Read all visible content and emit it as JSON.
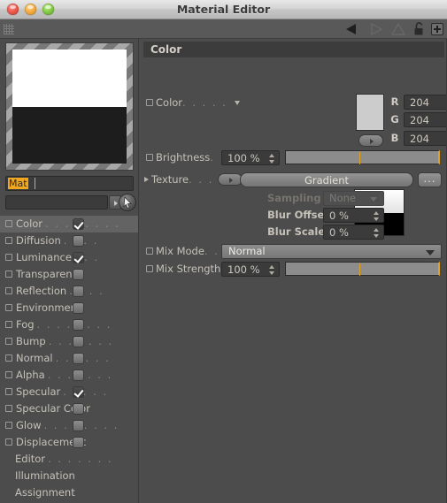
{
  "window": {
    "title": "Material Editor",
    "controls": [
      "close",
      "minimize",
      "zoom"
    ]
  },
  "toolbar": {
    "icons": [
      {
        "name": "back-arrow-icon",
        "label": "Back",
        "enabled": true
      },
      {
        "name": "forward-arrow-icon",
        "label": "Forward",
        "enabled": false
      },
      {
        "name": "up-arrow-icon",
        "label": "Up",
        "enabled": false
      },
      {
        "name": "unlock-icon",
        "label": "Unlock",
        "enabled": true
      },
      {
        "name": "add-icon",
        "label": "+",
        "enabled": true
      }
    ]
  },
  "left_panel": {
    "material_name": "Mat",
    "filter_value": "",
    "channels": [
      {
        "label": "Color",
        "dots": ". . . . . . . .",
        "checked": true,
        "selected": true
      },
      {
        "label": "Diffusion",
        "dots": ". . . .",
        "checked": false,
        "selected": false
      },
      {
        "label": "Luminance",
        "dots": ". . .",
        "checked": true,
        "selected": false
      },
      {
        "label": "Transparency",
        "dots": "",
        "checked": false,
        "selected": false
      },
      {
        "label": "Reflection",
        "dots": ". . . .",
        "checked": false,
        "selected": false
      },
      {
        "label": "Environment",
        "dots": "",
        "checked": false,
        "selected": false
      },
      {
        "label": "Fog",
        "dots": ". . . . . . . .",
        "checked": false,
        "selected": false
      },
      {
        "label": "Bump",
        "dots": ". . . . . . .",
        "checked": false,
        "selected": false
      },
      {
        "label": "Normal",
        "dots": ". . . . . .",
        "checked": false,
        "selected": false
      },
      {
        "label": "Alpha",
        "dots": ". . . . . . .",
        "checked": false,
        "selected": false
      },
      {
        "label": "Specular",
        "dots": ". . . . .",
        "checked": true,
        "selected": false
      },
      {
        "label": "Specular Color",
        "dots": "",
        "checked": false,
        "selected": false
      },
      {
        "label": "Glow",
        "dots": ". . . . . . . .",
        "checked": false,
        "selected": false
      },
      {
        "label": "Displacement",
        "dots": "",
        "checked": false,
        "selected": false
      }
    ],
    "pages": [
      {
        "label": "Editor",
        "dots": ". . . . . . ."
      },
      {
        "label": "Illumination",
        "dots": ""
      },
      {
        "label": "Assignment",
        "dots": ""
      }
    ]
  },
  "right_panel": {
    "section_title": "Color",
    "color": {
      "label": "Color",
      "dots": ". . . . .",
      "swatch_hex": "#cccccc",
      "channels": [
        {
          "letter": "R",
          "value": "204",
          "pct": 80
        },
        {
          "letter": "G",
          "value": "204",
          "pct": 80
        },
        {
          "letter": "B",
          "value": "204",
          "pct": 80
        }
      ]
    },
    "brightness": {
      "label": "Brightness",
      "dots": ". .",
      "value": "100 %",
      "tick_pct": 62
    },
    "texture": {
      "label": "Texture",
      "dots": ". . . . .",
      "value": "Gradient",
      "more_label": "...",
      "sampling": {
        "label": "Sampling",
        "value": "None",
        "enabled": false
      },
      "blur_offset": {
        "label": "Blur Offset",
        "value": "0 %"
      },
      "blur_scale": {
        "label": "Blur Scale",
        "value": "0 %"
      }
    },
    "mix_mode": {
      "label": "Mix Mode",
      "dots": ". . .",
      "value": "Normal"
    },
    "mix_strength": {
      "label": "Mix Strength",
      "dots": "",
      "value": "100 %",
      "tick_pct": 62
    }
  },
  "colors": {
    "panel_bg": "#4c4c4c",
    "section_bg": "#3c3c3c",
    "field_bg": "#3b3b3b",
    "accent_orange": "#e0a020",
    "text": "#c5c1b8"
  }
}
